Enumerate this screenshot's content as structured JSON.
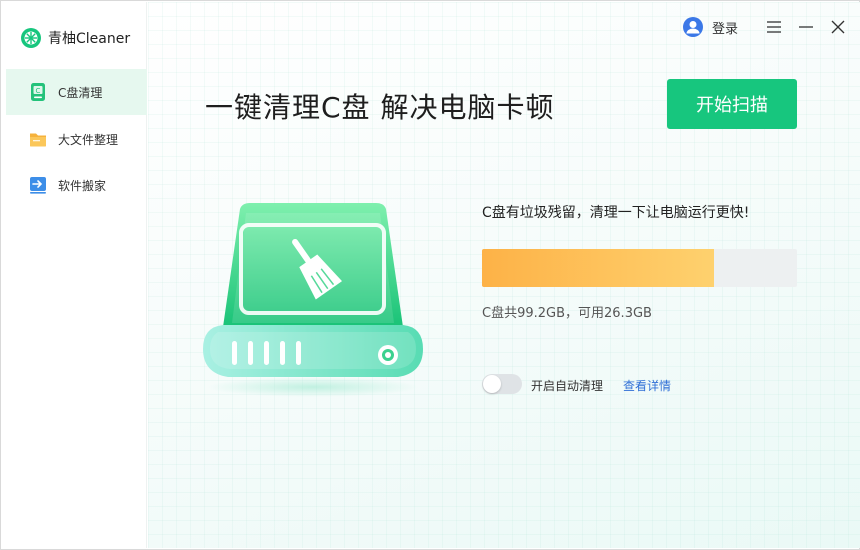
{
  "app": {
    "name": "青柚Cleaner"
  },
  "sidebar": {
    "items": [
      {
        "label": "C盘清理",
        "icon": "drive-clean-icon",
        "active": true
      },
      {
        "label": "大文件整理",
        "icon": "folder-icon",
        "active": false
      },
      {
        "label": "软件搬家",
        "icon": "move-software-icon",
        "active": false
      }
    ]
  },
  "header": {
    "login_label": "登录"
  },
  "main": {
    "headline": "一键清理C盘 解决电脑卡顿",
    "scan_button": "开始扫描",
    "status_text": "C盘有垃圾残留，清理一下让电脑运行更快!",
    "usage_text": "C盘共99.2GB，可用26.3GB",
    "auto_clean_label": "开启自动清理",
    "detail_link": "查看详情",
    "auto_clean_enabled": false,
    "disk_used_fraction": 0.735
  },
  "colors": {
    "accent": "#17c67e",
    "progress_start": "#fdb247",
    "progress_end": "#fed16e",
    "link": "#2f6fd6",
    "sidebar_active_bg": "#e6f8ef"
  }
}
